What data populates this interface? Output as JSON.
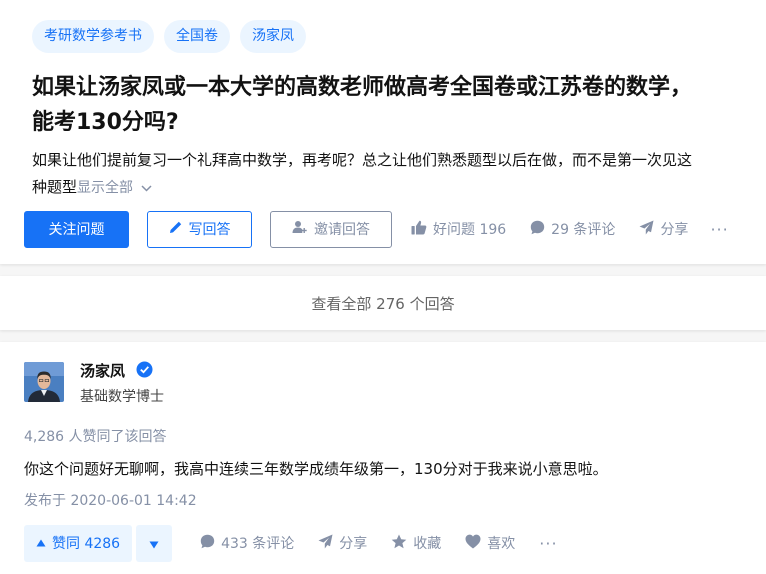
{
  "question": {
    "topics": [
      "考研数学参考书",
      "全国卷",
      "汤家凤"
    ],
    "title_line1": "如果让汤家凤或一本大学的高数老师做高考全国卷或江苏卷的数学，",
    "title_line2": "能考130分吗?",
    "detail_line1": "如果让他们提前复习一个礼拜高中数学，再考呢？总之让他们熟悉题型以后在做，而不是第一次见这",
    "detail_line2": "种题型",
    "show_all": "显示全部"
  },
  "question_actions": {
    "follow": "关注问题",
    "write_answer": "写回答",
    "invite": "邀请回答",
    "good_question": "好问题 196",
    "comments": "29 条评论",
    "share": "分享",
    "more": "···"
  },
  "view_all": "查看全部 276 个回答",
  "answer": {
    "author_name": "汤家凤",
    "author_bio": "基础数学博士",
    "votes_text": "4,286 人赞同了该回答",
    "content": "你这个问题好无聊啊，我高中连续三年数学成绩年级第一，130分对于我来说小意思啦。",
    "published": "发布于 2020-06-01 14:42"
  },
  "answer_actions": {
    "vote_up": "赞同 4286",
    "comments": "433 条评论",
    "share": "分享",
    "collect": "收藏",
    "like": "喜欢",
    "more": "···"
  },
  "colors": {
    "brand": "#1772f6",
    "tag_bg": "#ebf5ff",
    "muted": "#8590a6"
  }
}
